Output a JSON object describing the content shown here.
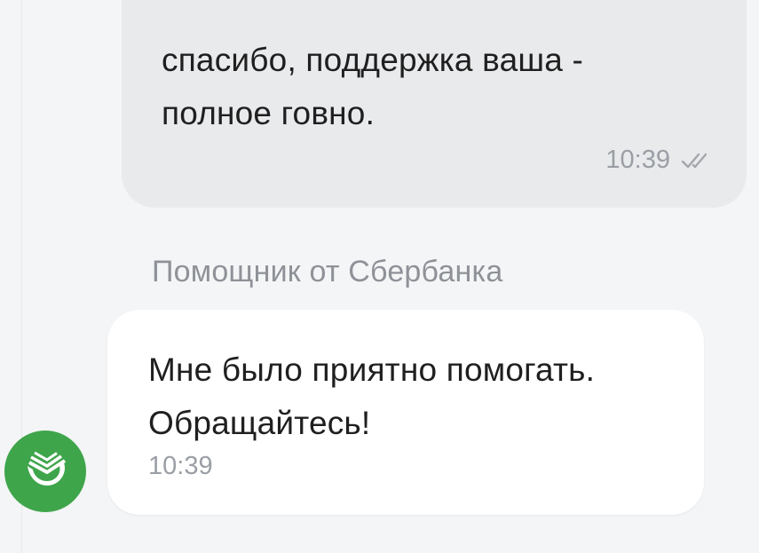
{
  "messages": {
    "outgoing": {
      "text_line1": "спасибо, поддержка ваша -",
      "text_line2": "полное говно.",
      "time": "10:39",
      "status_icon": "double-check-icon"
    },
    "incoming": {
      "sender": "Помощник от Сбербанка",
      "text_line1": "Мне было приятно помогать.",
      "text_line2": "Обращайтесь!",
      "time": "10:39",
      "avatar_icon": "sberbank-logo-icon"
    }
  },
  "colors": {
    "background": "#f4f5f6",
    "outgoing_bubble": "#e9eaec",
    "incoming_bubble": "#ffffff",
    "avatar": "#3fa54b",
    "meta_text": "#9a9ea5"
  }
}
